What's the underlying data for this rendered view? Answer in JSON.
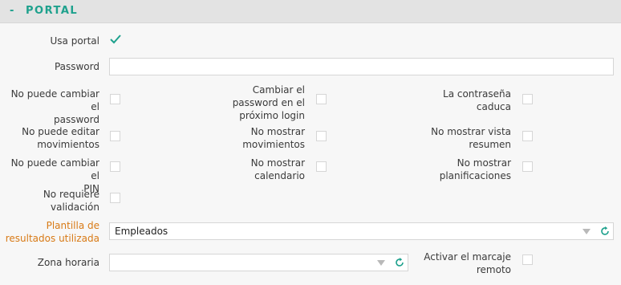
{
  "section": {
    "toggle": "-",
    "title": "PORTAL"
  },
  "fields": {
    "usa_portal": {
      "label": "Usa portal",
      "checked": true
    },
    "password": {
      "label": "Password",
      "value": ""
    },
    "no_puede_cambiar_password": {
      "line1": "No puede cambiar el",
      "line2": "password",
      "checked": false
    },
    "cambiar_password_proximo": {
      "line1": "Cambiar el",
      "line2": "password en el",
      "line3": "próximo login",
      "checked": false
    },
    "contrasena_caduca": {
      "line1": "La contraseña",
      "line2": "caduca",
      "checked": false
    },
    "no_puede_editar_movimientos": {
      "line1": "No puede editar",
      "line2": "movimientos",
      "checked": false
    },
    "no_mostrar_movimientos": {
      "line1": "No mostrar",
      "line2": "movimientos",
      "checked": false
    },
    "no_mostrar_vista_resumen": {
      "line1": "No mostrar vista",
      "line2": "resumen",
      "checked": false
    },
    "no_puede_cambiar_pin": {
      "line1": "No puede cambiar el",
      "line2": "PIN",
      "checked": false
    },
    "no_mostrar_calendario": {
      "line1": "No mostrar",
      "line2": "calendario",
      "checked": false
    },
    "no_mostrar_planificaciones": {
      "line1": "No mostrar",
      "line2": "planificaciones",
      "checked": false
    },
    "no_requiere_validacion": {
      "line1": "No requiere",
      "line2": "validación",
      "checked": false
    },
    "plantilla_resultados": {
      "line1": "Plantilla de",
      "line2": "resultados utilizada",
      "value": "Empleados"
    },
    "zona_horaria": {
      "label": "Zona horaria",
      "value": ""
    },
    "activar_marcaje_remoto": {
      "line1": "Activar el marcaje",
      "line2": "remoto",
      "checked": false
    }
  },
  "colors": {
    "accent": "#1ea18d",
    "highlight_label": "#d87a16",
    "border": "#d6d6d6",
    "background": "#f7f7f7"
  },
  "icons": {
    "check": "check-icon",
    "dropdown": "chevron-down-icon",
    "refresh": "refresh-icon"
  }
}
